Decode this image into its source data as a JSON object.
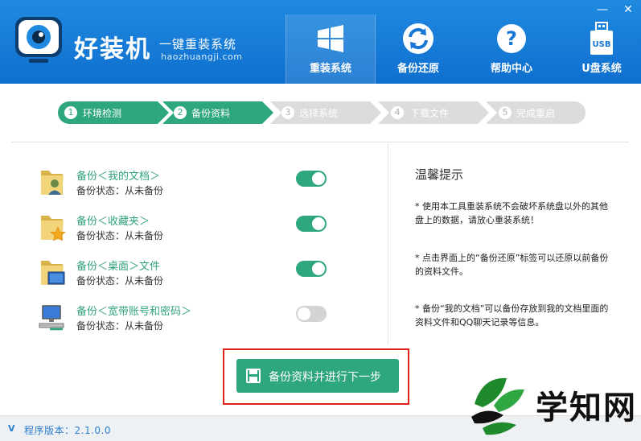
{
  "header": {
    "brand": "好装机",
    "slogan": "一键重装系统",
    "domain": "haozhuangji.com",
    "nav": [
      {
        "label": "重装系统",
        "icon": "windows-icon"
      },
      {
        "label": "备份还原",
        "icon": "sync-icon"
      },
      {
        "label": "帮助中心",
        "icon": "help-icon"
      },
      {
        "label": "U盘系统",
        "icon": "usb-icon"
      }
    ],
    "usb_icon_text": "USB",
    "minimize": "—",
    "close": "✕"
  },
  "steps": [
    {
      "num": "1",
      "label": "环境检测",
      "state": "done"
    },
    {
      "num": "2",
      "label": "备份资料",
      "state": "active"
    },
    {
      "num": "3",
      "label": "选择系统",
      "state": "pending"
    },
    {
      "num": "4",
      "label": "下载文件",
      "state": "pending"
    },
    {
      "num": "5",
      "label": "完成重启",
      "state": "pending"
    }
  ],
  "backup_items": [
    {
      "title": "备份＜我的文档＞",
      "status": "备份状态：从未备份",
      "enabled": true,
      "icon": "documents-folder-icon"
    },
    {
      "title": "备份＜收藏夹＞",
      "status": "备份状态：从未备份",
      "enabled": true,
      "icon": "favorites-folder-icon"
    },
    {
      "title": "备份＜桌面＞文件",
      "status": "备份状态：从未备份",
      "enabled": true,
      "icon": "desktop-folder-icon"
    },
    {
      "title": "备份＜宽带账号和密码＞",
      "status": "备份状态：从未备份",
      "enabled": false,
      "icon": "network-computer-icon"
    }
  ],
  "tips": {
    "title": "温馨提示",
    "items": [
      "* 使用本工具重装系统不会破坏系统盘以外的其他盘上的数据，请放心重装系统！",
      "* 点击界面上的“备份还原”标签可以还原以前备份的资料文件。",
      "* 备份“我的文档”可以备份存放到我的文档里面的资料文件和QQ聊天记录等信息。"
    ]
  },
  "main_button": {
    "label": "备份资料并进行下一步"
  },
  "footer": {
    "version_badge": "V",
    "version": "程序版本：2.1.0.0"
  },
  "watermark": {
    "text": "学知网"
  },
  "colors": {
    "header": "#1677d6",
    "accent": "#2fa77c",
    "pending": "#dcdcdc",
    "highlight": "#e0201a"
  }
}
